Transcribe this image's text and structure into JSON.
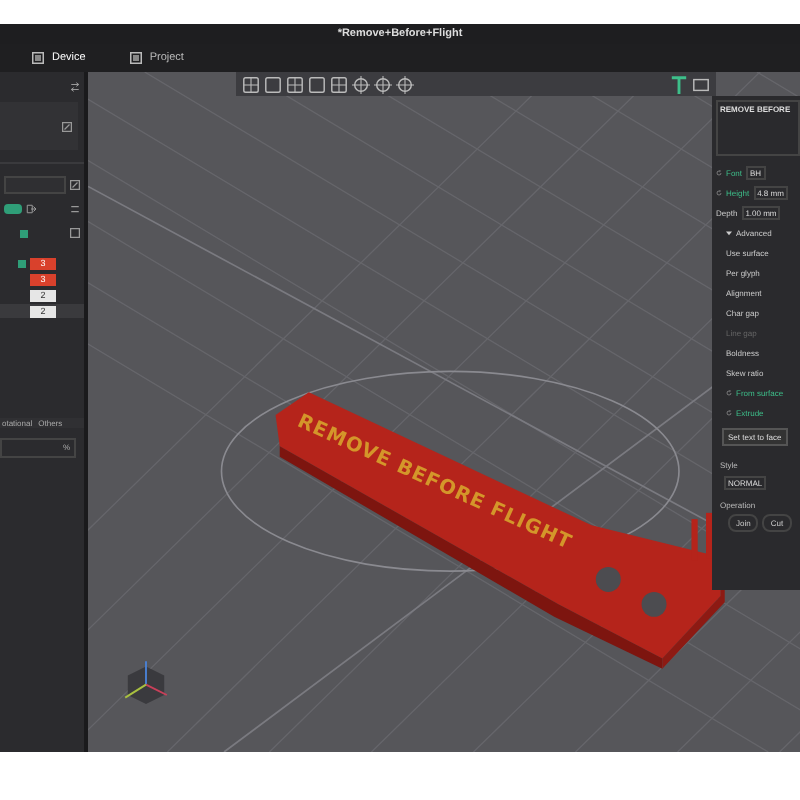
{
  "window": {
    "title": "*Remove+Before+Flight"
  },
  "tabs": [
    {
      "label": "Device",
      "selected": true
    },
    {
      "label": "Project",
      "selected": false
    }
  ],
  "left_panel": {
    "toggle": {
      "on": true
    },
    "square_toggle": {
      "on": true
    },
    "checkbox": {
      "checked": true
    },
    "badges": [
      {
        "text": "3",
        "kind": "warn"
      },
      {
        "text": "3",
        "kind": "warn"
      },
      {
        "text": "2",
        "kind": "plain"
      },
      {
        "text": "2",
        "kind": "plain"
      }
    ],
    "segments": [
      {
        "label": "otational",
        "selected": false
      },
      {
        "label": "Others",
        "selected": false
      }
    ],
    "field": {
      "unit": "%"
    }
  },
  "viewport": {
    "model_text": "REMOVE BEFORE FLIGHT"
  },
  "text_panel": {
    "text": "REMOVE BEFORE",
    "rows": [
      {
        "label": "Font",
        "value": "BH",
        "kind": "field",
        "accent": true
      },
      {
        "label": "Height",
        "value": "4.8 mm",
        "kind": "field",
        "accent": true
      },
      {
        "label": "Depth",
        "value": "1.00 mm",
        "kind": "field",
        "accent": false
      },
      {
        "label": "Advanced",
        "kind": "header",
        "accent": false
      },
      {
        "label": "Use surface",
        "kind": "plain",
        "accent": false,
        "disabled": false
      },
      {
        "label": "Per glyph",
        "kind": "plain",
        "accent": false,
        "disabled": false
      },
      {
        "label": "Alignment",
        "kind": "plain",
        "accent": false,
        "disabled": false
      },
      {
        "label": "Char gap",
        "kind": "plain",
        "accent": false,
        "disabled": false
      },
      {
        "label": "Line gap",
        "kind": "plain",
        "accent": false,
        "disabled": true
      },
      {
        "label": "Boldness",
        "kind": "plain",
        "accent": false,
        "disabled": false
      },
      {
        "label": "Skew ratio",
        "kind": "plain",
        "accent": false,
        "disabled": false
      },
      {
        "label": "From surface",
        "kind": "plain",
        "accent": true,
        "disabled": false
      },
      {
        "label": "Extrude",
        "kind": "plain",
        "accent": true,
        "disabled": false
      }
    ],
    "action": "Set text to face",
    "style_label": "Style",
    "style_value": "NORMAL",
    "operation_label": "Operation",
    "operations": [
      {
        "label": "Join",
        "selected": false
      },
      {
        "label": "Cut",
        "selected": false
      }
    ]
  }
}
